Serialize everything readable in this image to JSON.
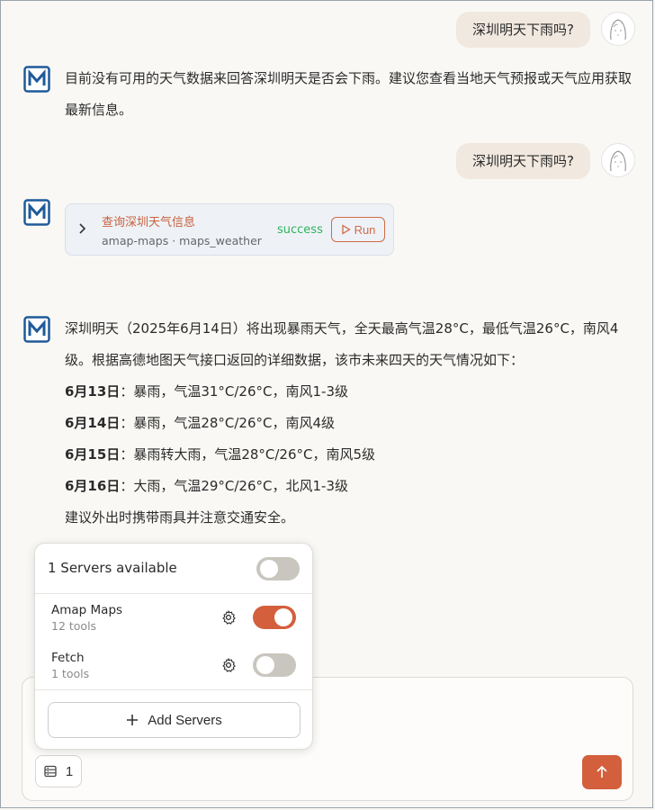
{
  "chat": {
    "user_msg_1": "深圳明天下雨吗?",
    "bot_msg_1": "目前没有可用的天气数据来回答深圳明天是否会下雨。建议您查看当地天气预报或天气应用获取最新信息。",
    "user_msg_2": "深圳明天下雨吗?",
    "tool_call": {
      "title": "查询深圳天气信息",
      "subtitle": "amap-maps · maps_weather",
      "status": "success",
      "run_label": "Run"
    },
    "answer": {
      "intro": "深圳明天（2025年6月14日）将出现暴雨天气，全天最高气温28°C，最低气温26°C，南风4级。根据高德地图天气接口返回的详细数据，该市未来四天的天气情况如下：",
      "days": [
        {
          "date": "6月13日",
          "desc": "：暴雨，气温31°C/26°C，南风1-3级"
        },
        {
          "date": "6月14日",
          "desc": "：暴雨，气温28°C/26°C，南风4级"
        },
        {
          "date": "6月15日",
          "desc": "：暴雨转大雨，气温28°C/26°C，南风5级"
        },
        {
          "date": "6月16日",
          "desc": "：大雨，气温29°C/26°C，北风1-3级"
        }
      ],
      "closing": "建议外出时携带雨具并注意交通安全。"
    }
  },
  "servers_popover": {
    "header": "1 Servers available",
    "master_toggle_on": false,
    "servers": [
      {
        "name": "Amap Maps",
        "tools": "12 tools",
        "enabled": true
      },
      {
        "name": "Fetch",
        "tools": "1 tools",
        "enabled": false
      }
    ],
    "add_label": "Add Servers"
  },
  "composer": {
    "server_count": "1"
  },
  "colors": {
    "accent": "#d45f3c",
    "success": "#2fb35a",
    "user_bubble": "#f1e8df",
    "brand": "#1f5a99"
  },
  "icons": {
    "bot_logo": "m-logo-icon",
    "user_avatar": "avatar-sketch",
    "expand": "chevron-right-icon",
    "run": "play-icon",
    "settings": "gear-icon",
    "add": "plus-icon",
    "servers": "server-list-icon",
    "send": "arrow-up-icon"
  }
}
